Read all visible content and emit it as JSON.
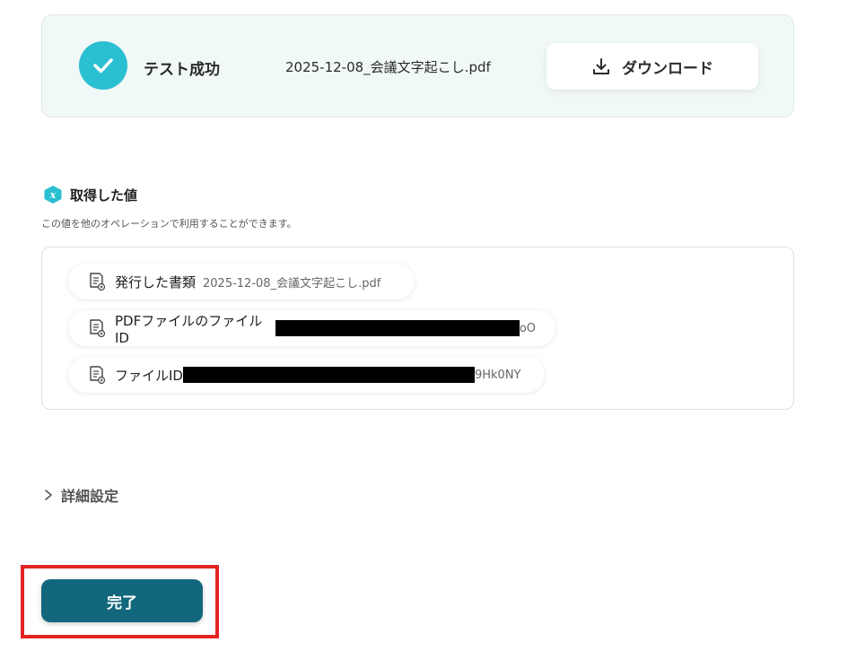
{
  "test_result": {
    "status_label": "テスト成功",
    "file_name": "2025-12-08_会議文字起こし.pdf",
    "download_label": "ダウンロード"
  },
  "obtained_values": {
    "title": "取得した値",
    "description": "この値を他のオペレーションで利用することができます。",
    "items": [
      {
        "label": "発行した書類",
        "value": "2025-12-08_会議文字起こし.pdf"
      },
      {
        "label": "PDFファイルのファイルID",
        "value_tail": "oO"
      },
      {
        "label": "ファイルID",
        "value_tail": "9Hk0NY"
      }
    ]
  },
  "advanced_settings": {
    "label": "詳細設定"
  },
  "complete_button": {
    "label": "完了"
  },
  "colors": {
    "accent_teal": "#2bbfd2",
    "primary_button": "#13677d",
    "highlight_outline": "#e32424"
  }
}
